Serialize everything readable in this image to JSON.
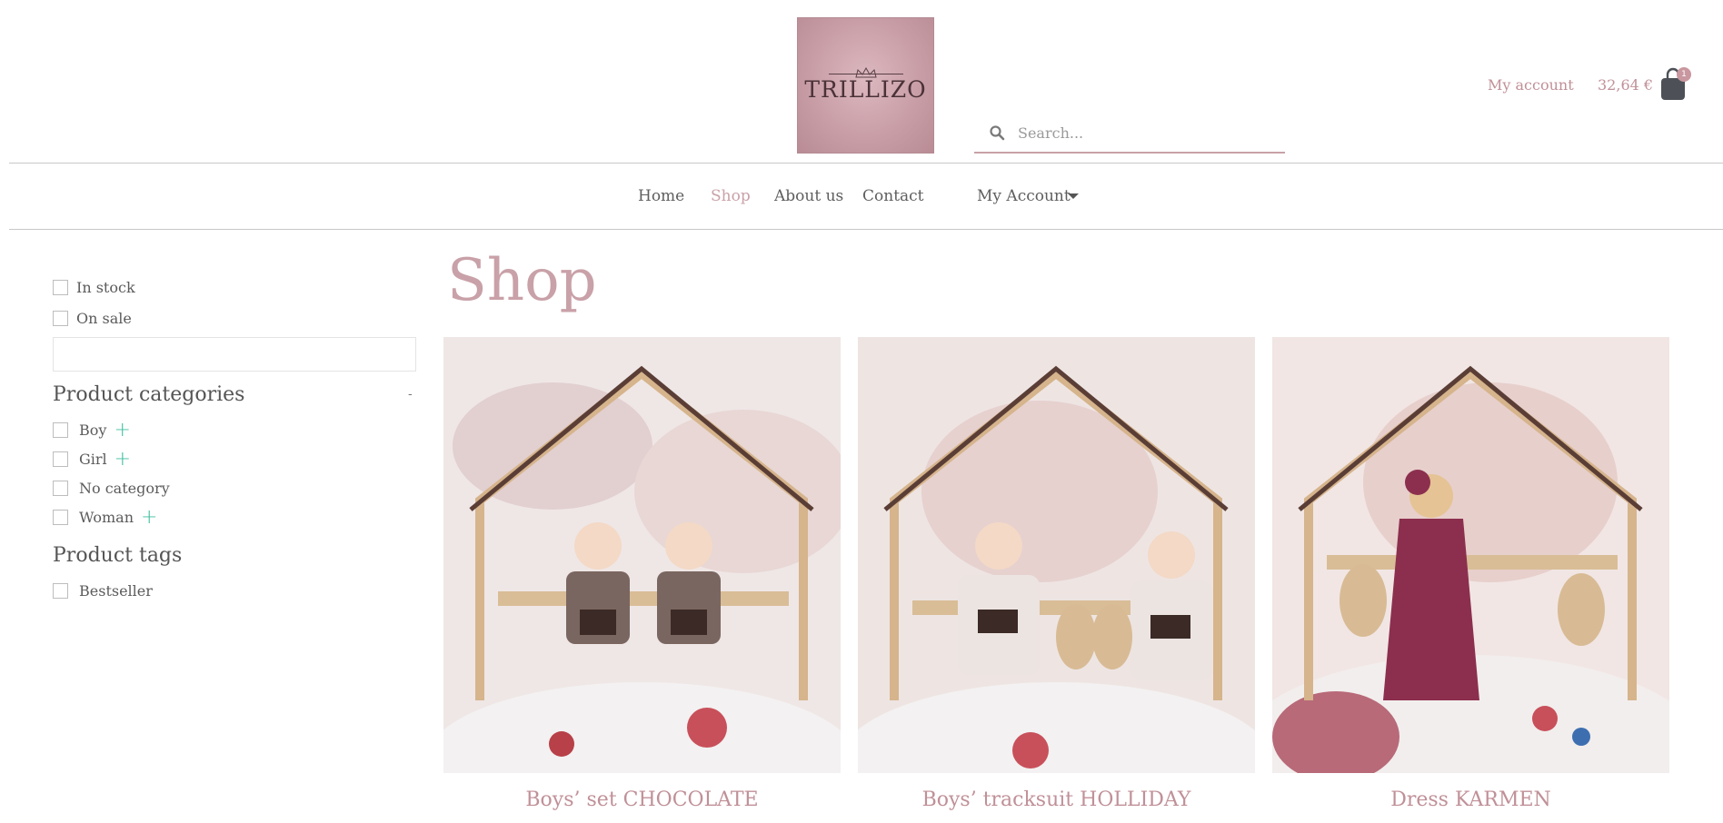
{
  "brand": {
    "logo_text": "TRILLIZO"
  },
  "search": {
    "placeholder": "Search..."
  },
  "header": {
    "account_link": "My account",
    "cart_total": "32,64 €",
    "cart_count": "1"
  },
  "nav": {
    "items": [
      {
        "label": "Home",
        "active": false
      },
      {
        "label": "Shop",
        "active": true
      },
      {
        "label": "About us",
        "active": false
      },
      {
        "label": "Contact",
        "active": false
      },
      {
        "label": "My Account",
        "active": false,
        "has_dropdown": true
      }
    ]
  },
  "sidebar": {
    "filters": [
      {
        "label": "In stock"
      },
      {
        "label": "On sale"
      }
    ],
    "categories_title": "Product categories",
    "categories_toggle": "-",
    "categories": [
      {
        "label": "Boy",
        "expandable": true
      },
      {
        "label": "Girl",
        "expandable": true
      },
      {
        "label": "No category",
        "expandable": false
      },
      {
        "label": "Woman",
        "expandable": true
      }
    ],
    "tags_title": "Product tags",
    "tags": [
      {
        "label": "Bestseller"
      }
    ]
  },
  "main": {
    "title": "Shop",
    "products": [
      {
        "name": "Boys’ set CHOCOLATE"
      },
      {
        "name": "Boys’ tracksuit HOLLIDAY"
      },
      {
        "name": "Dress KARMEN"
      }
    ]
  },
  "colors": {
    "accent": "#c9a1a8",
    "plus": "#3fbf9f",
    "cart": "#4d5157"
  }
}
